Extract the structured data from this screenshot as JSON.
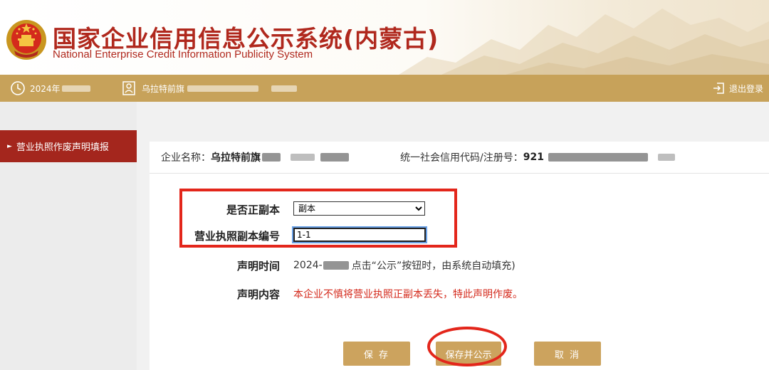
{
  "header": {
    "title": "国家企业信用信息公示系统(内蒙古)",
    "subtitle": "National Enterprise Credit Information Publicity System",
    "emblem_icon": "national-emblem-icon"
  },
  "topbar": {
    "date_prefix": "2024年",
    "user_prefix": "乌拉特前旗",
    "logout_label": "退出登录",
    "clock_icon": "clock-icon",
    "user_icon": "user-icon",
    "logout_icon": "logout-icon",
    "bg_color": "#c7a25a"
  },
  "sidebar": {
    "items": [
      {
        "label": "营业执照作废声明填报",
        "active": true,
        "arrow": "►"
      }
    ],
    "active_color": "#a4261d"
  },
  "company": {
    "name_label": "企业名称：",
    "name_prefix": "乌拉特前旗",
    "code_label": "统一社会信用代码/注册号：",
    "code_prefix": "921"
  },
  "form": {
    "copy_type_label": "是否正副本",
    "copy_type_value": "副本",
    "copy_type_options": [
      "副本"
    ],
    "license_no_label": "营业执照副本编号",
    "license_no_value": "1-1",
    "time_label": "声明时间",
    "time_prefix": "2024-",
    "time_suffix": "点击“公示”按钮时，由系统自动填充)",
    "content_label": "声明内容",
    "content_value": "本企业不慎将营业执照正副本丢失，特此声明作废。"
  },
  "buttons": {
    "save": "保 存",
    "save_publish": "保存并公示",
    "cancel": "取 消",
    "color": "#cca35e"
  },
  "annotations": {
    "highlight_color": "#e3261b"
  }
}
